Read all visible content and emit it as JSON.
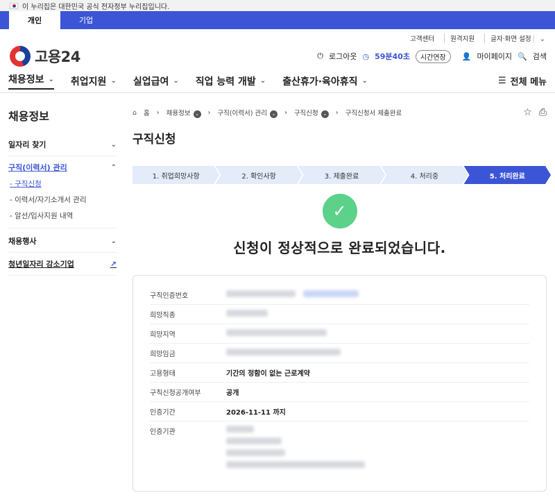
{
  "gov_banner": "이 누리집은 대한민국 공식 전자정부 누리집입니다.",
  "audience_tabs": [
    "개인",
    "기업"
  ],
  "util_links": [
    "고객센터",
    "원격지원",
    "글자·화면 설정"
  ],
  "logo": "고용24",
  "header": {
    "logout": "로그아웃",
    "timer": "59분40초",
    "extend": "시간연장",
    "mypage": "마이페이지",
    "search": "검색"
  },
  "gnb": [
    "채용정보",
    "취업지원",
    "실업급여",
    "직업 능력 개발",
    "출산휴가·육아휴직"
  ],
  "all_menu": "전체 메뉴",
  "lnb": {
    "title": "채용정보",
    "items": [
      "일자리 찾기",
      "구직(이력서) 관리",
      "채용행사",
      "청년일자리 강소기업"
    ],
    "sub_items": [
      "- 구직신청",
      "- 이력서/자기소개서 관리",
      "- 알선/입사지원 내역"
    ]
  },
  "breadcrumb": [
    "홈",
    "채용정보",
    "구직(이력서) 관리",
    "구직신청",
    "구직신청서 제출완료"
  ],
  "page_title": "구직신청",
  "steps": [
    "1. 취업희망사항",
    "2. 확인사항",
    "3. 제출완료",
    "4. 처리중",
    "5. 처리완료"
  ],
  "completion_message": "신청이 정상적으로 완료되었습니다.",
  "details": {
    "labels": [
      "구직인증번호",
      "희망직종",
      "희망지역",
      "희망임금",
      "고용형태",
      "구직신청공개여부",
      "인증기간",
      "인증기관"
    ],
    "employment_type": "기간의 정함이 없는 근로계약",
    "public": "공개",
    "cert_period": "2026-11-11 까지"
  }
}
